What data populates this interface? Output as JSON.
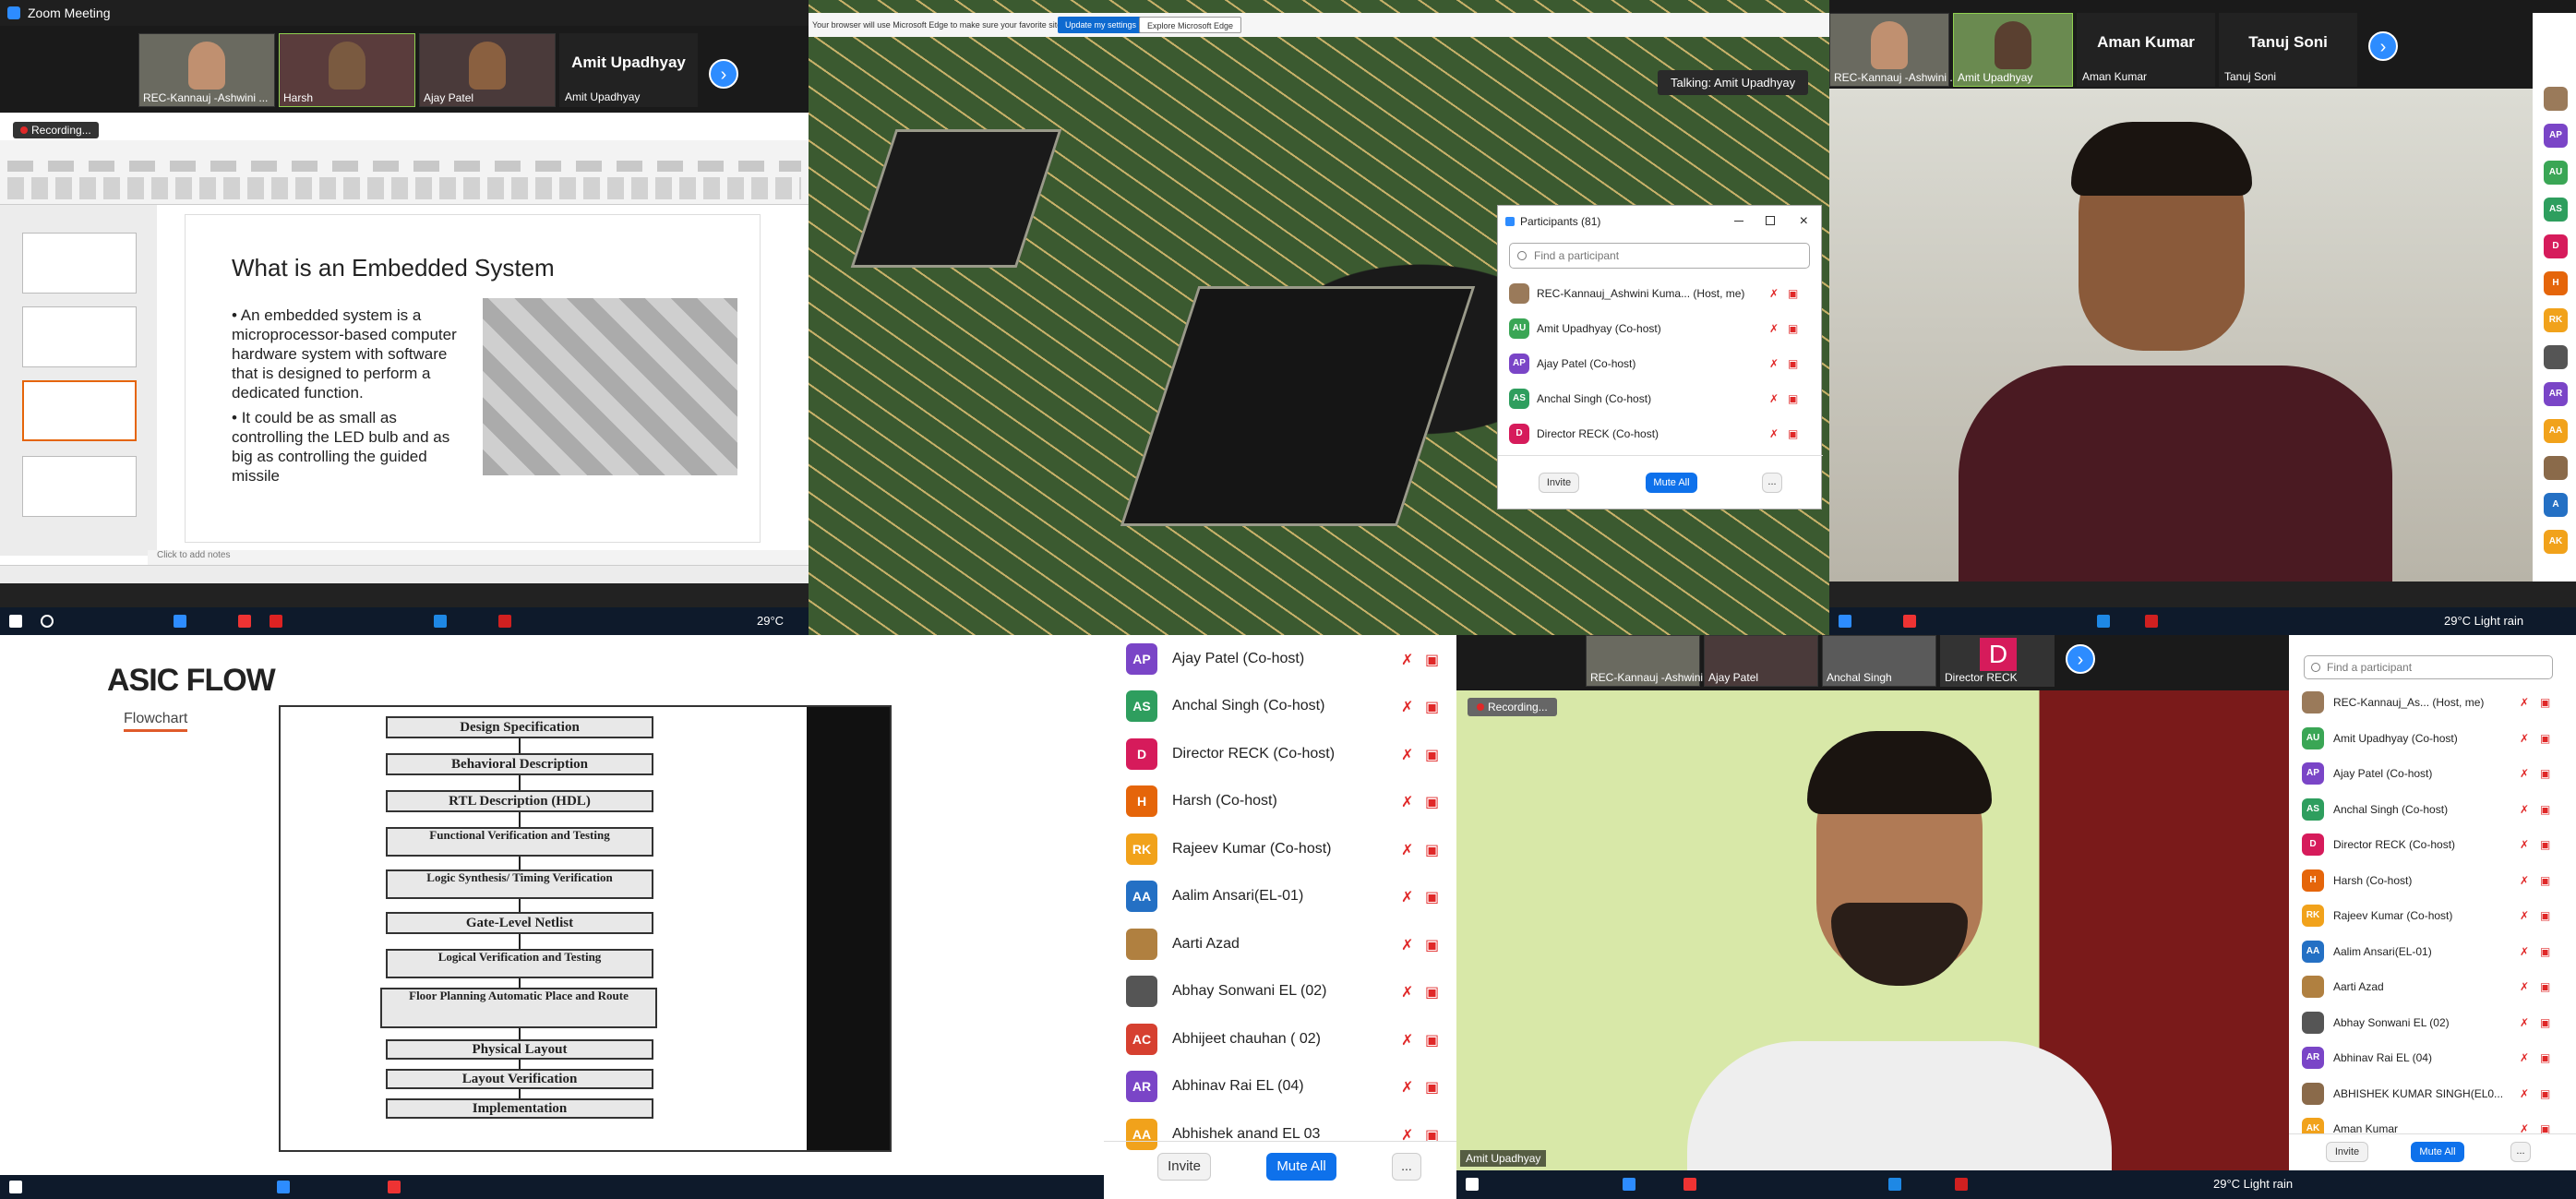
{
  "colors": {
    "zoom_blue": "#2d8cff",
    "mute_red": "#e02828",
    "taskbar": "#0e1a2b"
  },
  "tile1": {
    "window_title": "Zoom Meeting",
    "recording": "Recording...",
    "thumbs": [
      "REC-Kannauj -Ashwini ...",
      "Harsh",
      "Ajay Patel"
    ],
    "name_tile": {
      "title": "Amit Upadhyay",
      "sub": "Amit Upadhyay"
    },
    "slide": {
      "title": "What is an Embedded System",
      "bullets": [
        "An embedded system is a microprocessor-based computer hardware system with software that is designed to perform a dedicated function.",
        "It could be as small as controlling the LED bulb and as big as controlling the guided missile"
      ],
      "notes": "Click to add notes"
    },
    "weather": "29°C"
  },
  "tile2": {
    "browser_banner": "Your browser will use Microsoft Edge to make sure your favorite sites work",
    "banner_btn1": "Update my settings",
    "banner_btn2": "Explore Microsoft Edge",
    "talking": "Talking: Amit Upadhyay",
    "participants_title": "Participants (81)",
    "search_placeholder": "Find a participant",
    "participants": [
      {
        "initials": "",
        "name": "REC-Kannauj_Ashwini Kuma... (Host, me)",
        "color": "#9a7a5a"
      },
      {
        "initials": "AU",
        "name": "Amit Upadhyay (Co-host)",
        "color": "#3aa655"
      },
      {
        "initials": "AP",
        "name": "Ajay Patel (Co-host)",
        "color": "#7a45c7"
      },
      {
        "initials": "AS",
        "name": "Anchal Singh (Co-host)",
        "color": "#2e9e5e"
      },
      {
        "initials": "D",
        "name": "Director RECK (Co-host)",
        "color": "#d61b5b"
      }
    ],
    "invite": "Invite",
    "mute_all": "Mute All",
    "more": "..."
  },
  "tile3": {
    "thumbs": [
      "REC-Kannauj -Ashwini ...",
      "Amit Upadhyay"
    ],
    "name_tiles": [
      {
        "title": "Aman Kumar",
        "sub": "Aman Kumar"
      },
      {
        "title": "Tanuj Soni",
        "sub": "Tanuj Soni"
      }
    ],
    "side_avatars": [
      {
        "initials": "",
        "color": "#9a7a5a"
      },
      {
        "initials": "AP",
        "color": "#7a45c7"
      },
      {
        "initials": "AU",
        "color": "#3aa655"
      },
      {
        "initials": "AS",
        "color": "#2e9e5e"
      },
      {
        "initials": "D",
        "color": "#d61b5b"
      },
      {
        "initials": "H",
        "color": "#e5650a"
      },
      {
        "initials": "RK",
        "color": "#f1a21b"
      },
      {
        "initials": "",
        "color": "#555555"
      },
      {
        "initials": "AR",
        "color": "#7a45c7"
      },
      {
        "initials": "AA",
        "color": "#f1a21b"
      },
      {
        "initials": "",
        "color": "#8a6a4a"
      },
      {
        "initials": "A",
        "color": "#2470c4"
      },
      {
        "initials": "AK",
        "color": "#f1a21b"
      }
    ],
    "weather": "29°C Light rain"
  },
  "tile4": {
    "title": "ASIC FLOW",
    "subtitle": "Flowchart",
    "steps": [
      "Design Specification",
      "Behavioral Description",
      "RTL Description (HDL)",
      "Functional Verification and Testing",
      "Logic Synthesis/ Timing Verification",
      "Gate-Level Netlist",
      "Logical Verification and Testing",
      "Floor Planning Automatic Place and Route",
      "Physical Layout",
      "Layout Verification",
      "Implementation"
    ]
  },
  "tile5": {
    "participants": [
      {
        "initials": "AP",
        "name": "Ajay Patel (Co-host)",
        "color": "#7a45c7"
      },
      {
        "initials": "AS",
        "name": "Anchal Singh (Co-host)",
        "color": "#2e9e5e"
      },
      {
        "initials": "D",
        "name": "Director RECK (Co-host)",
        "color": "#d61b5b"
      },
      {
        "initials": "H",
        "name": "Harsh (Co-host)",
        "color": "#e5650a"
      },
      {
        "initials": "RK",
        "name": "Rajeev Kumar (Co-host)",
        "color": "#f1a21b"
      },
      {
        "initials": "AA",
        "name": "Aalim Ansari(EL-01)",
        "color": "#2470c4"
      },
      {
        "initials": "",
        "name": "Aarti Azad",
        "color": "#b08040"
      },
      {
        "initials": "",
        "name": "Abhay Sonwani EL (02)",
        "color": "#555555"
      },
      {
        "initials": "AC",
        "name": "Abhijeet chauhan ( 02)",
        "color": "#d64030"
      },
      {
        "initials": "AR",
        "name": "Abhinav Rai EL (04)",
        "color": "#7a45c7"
      },
      {
        "initials": "AA",
        "name": "Abhishek anand EL 03",
        "color": "#f1a21b"
      }
    ],
    "invite": "Invite",
    "mute_all": "Mute All",
    "more": "..."
  },
  "tile6": {
    "thumbs": [
      "REC-Kannauj -Ashwini ...",
      "Ajay Patel",
      "Anchal Singh"
    ],
    "director_tile": {
      "initial": "D",
      "name": "Director RECK"
    },
    "recording": "Recording...",
    "video_label": "Amit Upadhyay",
    "search_placeholder": "Find a participant",
    "participants": [
      {
        "initials": "",
        "name": "REC-Kannauj_As... (Host, me)",
        "color": "#9a7a5a"
      },
      {
        "initials": "AU",
        "name": "Amit Upadhyay (Co-host)",
        "color": "#3aa655"
      },
      {
        "initials": "AP",
        "name": "Ajay Patel (Co-host)",
        "color": "#7a45c7"
      },
      {
        "initials": "AS",
        "name": "Anchal Singh (Co-host)",
        "color": "#2e9e5e"
      },
      {
        "initials": "D",
        "name": "Director RECK (Co-host)",
        "color": "#d61b5b"
      },
      {
        "initials": "H",
        "name": "Harsh (Co-host)",
        "color": "#e5650a"
      },
      {
        "initials": "RK",
        "name": "Rajeev Kumar (Co-host)",
        "color": "#f1a21b"
      },
      {
        "initials": "AA",
        "name": "Aalim Ansari(EL-01)",
        "color": "#2470c4"
      },
      {
        "initials": "",
        "name": "Aarti Azad",
        "color": "#b08040"
      },
      {
        "initials": "",
        "name": "Abhay Sonwani EL (02)",
        "color": "#555555"
      },
      {
        "initials": "AR",
        "name": "Abhinav Rai EL (04)",
        "color": "#7a45c7"
      },
      {
        "initials": "",
        "name": "ABHISHEK KUMAR SINGH(EL0...",
        "color": "#8a6a4a"
      },
      {
        "initials": "AK",
        "name": "Aman Kumar",
        "color": "#f1a21b"
      }
    ],
    "invite": "Invite",
    "mute_all": "Mute All",
    "more": "...",
    "weather": "29°C Light rain"
  }
}
